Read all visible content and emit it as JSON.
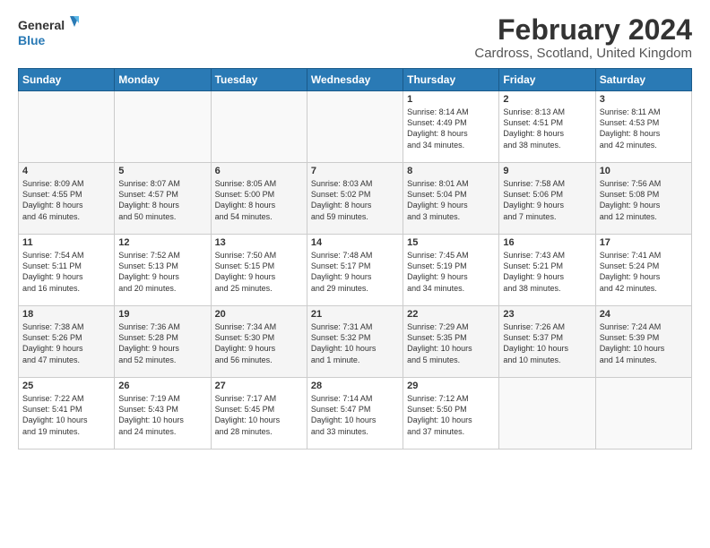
{
  "logo": {
    "line1": "General",
    "line2": "Blue"
  },
  "title": "February 2024",
  "subtitle": "Cardross, Scotland, United Kingdom",
  "headers": [
    "Sunday",
    "Monday",
    "Tuesday",
    "Wednesday",
    "Thursday",
    "Friday",
    "Saturday"
  ],
  "weeks": [
    [
      {
        "day": "",
        "info": ""
      },
      {
        "day": "",
        "info": ""
      },
      {
        "day": "",
        "info": ""
      },
      {
        "day": "",
        "info": ""
      },
      {
        "day": "1",
        "info": "Sunrise: 8:14 AM\nSunset: 4:49 PM\nDaylight: 8 hours\nand 34 minutes."
      },
      {
        "day": "2",
        "info": "Sunrise: 8:13 AM\nSunset: 4:51 PM\nDaylight: 8 hours\nand 38 minutes."
      },
      {
        "day": "3",
        "info": "Sunrise: 8:11 AM\nSunset: 4:53 PM\nDaylight: 8 hours\nand 42 minutes."
      }
    ],
    [
      {
        "day": "4",
        "info": "Sunrise: 8:09 AM\nSunset: 4:55 PM\nDaylight: 8 hours\nand 46 minutes."
      },
      {
        "day": "5",
        "info": "Sunrise: 8:07 AM\nSunset: 4:57 PM\nDaylight: 8 hours\nand 50 minutes."
      },
      {
        "day": "6",
        "info": "Sunrise: 8:05 AM\nSunset: 5:00 PM\nDaylight: 8 hours\nand 54 minutes."
      },
      {
        "day": "7",
        "info": "Sunrise: 8:03 AM\nSunset: 5:02 PM\nDaylight: 8 hours\nand 59 minutes."
      },
      {
        "day": "8",
        "info": "Sunrise: 8:01 AM\nSunset: 5:04 PM\nDaylight: 9 hours\nand 3 minutes."
      },
      {
        "day": "9",
        "info": "Sunrise: 7:58 AM\nSunset: 5:06 PM\nDaylight: 9 hours\nand 7 minutes."
      },
      {
        "day": "10",
        "info": "Sunrise: 7:56 AM\nSunset: 5:08 PM\nDaylight: 9 hours\nand 12 minutes."
      }
    ],
    [
      {
        "day": "11",
        "info": "Sunrise: 7:54 AM\nSunset: 5:11 PM\nDaylight: 9 hours\nand 16 minutes."
      },
      {
        "day": "12",
        "info": "Sunrise: 7:52 AM\nSunset: 5:13 PM\nDaylight: 9 hours\nand 20 minutes."
      },
      {
        "day": "13",
        "info": "Sunrise: 7:50 AM\nSunset: 5:15 PM\nDaylight: 9 hours\nand 25 minutes."
      },
      {
        "day": "14",
        "info": "Sunrise: 7:48 AM\nSunset: 5:17 PM\nDaylight: 9 hours\nand 29 minutes."
      },
      {
        "day": "15",
        "info": "Sunrise: 7:45 AM\nSunset: 5:19 PM\nDaylight: 9 hours\nand 34 minutes."
      },
      {
        "day": "16",
        "info": "Sunrise: 7:43 AM\nSunset: 5:21 PM\nDaylight: 9 hours\nand 38 minutes."
      },
      {
        "day": "17",
        "info": "Sunrise: 7:41 AM\nSunset: 5:24 PM\nDaylight: 9 hours\nand 42 minutes."
      }
    ],
    [
      {
        "day": "18",
        "info": "Sunrise: 7:38 AM\nSunset: 5:26 PM\nDaylight: 9 hours\nand 47 minutes."
      },
      {
        "day": "19",
        "info": "Sunrise: 7:36 AM\nSunset: 5:28 PM\nDaylight: 9 hours\nand 52 minutes."
      },
      {
        "day": "20",
        "info": "Sunrise: 7:34 AM\nSunset: 5:30 PM\nDaylight: 9 hours\nand 56 minutes."
      },
      {
        "day": "21",
        "info": "Sunrise: 7:31 AM\nSunset: 5:32 PM\nDaylight: 10 hours\nand 1 minute."
      },
      {
        "day": "22",
        "info": "Sunrise: 7:29 AM\nSunset: 5:35 PM\nDaylight: 10 hours\nand 5 minutes."
      },
      {
        "day": "23",
        "info": "Sunrise: 7:26 AM\nSunset: 5:37 PM\nDaylight: 10 hours\nand 10 minutes."
      },
      {
        "day": "24",
        "info": "Sunrise: 7:24 AM\nSunset: 5:39 PM\nDaylight: 10 hours\nand 14 minutes."
      }
    ],
    [
      {
        "day": "25",
        "info": "Sunrise: 7:22 AM\nSunset: 5:41 PM\nDaylight: 10 hours\nand 19 minutes."
      },
      {
        "day": "26",
        "info": "Sunrise: 7:19 AM\nSunset: 5:43 PM\nDaylight: 10 hours\nand 24 minutes."
      },
      {
        "day": "27",
        "info": "Sunrise: 7:17 AM\nSunset: 5:45 PM\nDaylight: 10 hours\nand 28 minutes."
      },
      {
        "day": "28",
        "info": "Sunrise: 7:14 AM\nSunset: 5:47 PM\nDaylight: 10 hours\nand 33 minutes."
      },
      {
        "day": "29",
        "info": "Sunrise: 7:12 AM\nSunset: 5:50 PM\nDaylight: 10 hours\nand 37 minutes."
      },
      {
        "day": "",
        "info": ""
      },
      {
        "day": "",
        "info": ""
      }
    ]
  ]
}
